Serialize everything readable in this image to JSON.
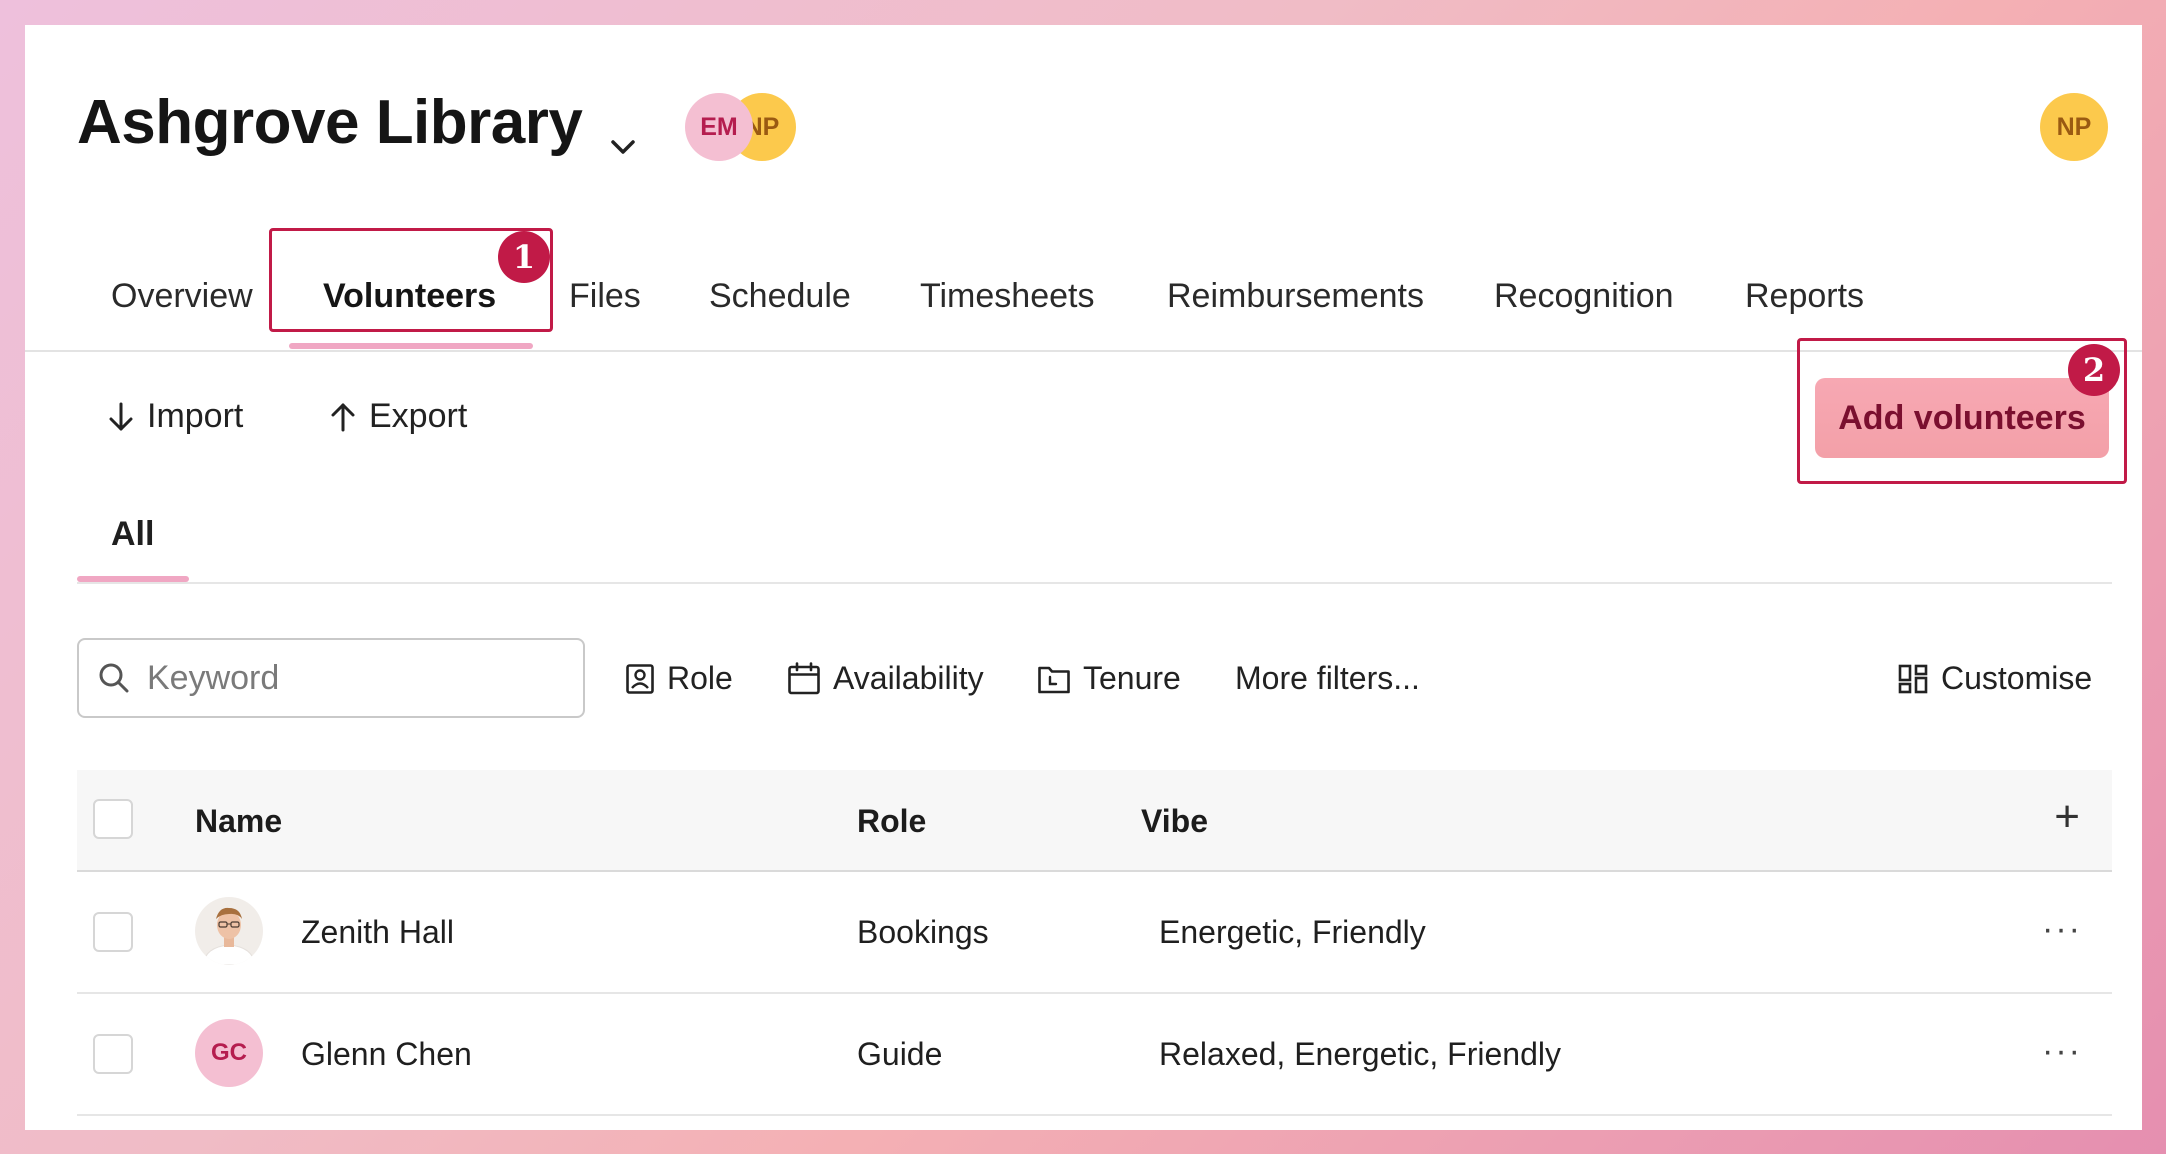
{
  "header": {
    "title": "Ashgrove Library",
    "member_avatars": [
      {
        "initials": "EM",
        "color": "#f4bfd2"
      },
      {
        "initials": "NP",
        "color": "#fcc94c"
      }
    ],
    "user_avatar": {
      "initials": "NP",
      "color": "#fcc94c"
    }
  },
  "tabs": [
    {
      "label": "Overview",
      "active": false
    },
    {
      "label": "Volunteers",
      "active": true
    },
    {
      "label": "Files",
      "active": false
    },
    {
      "label": "Schedule",
      "active": false
    },
    {
      "label": "Timesheets",
      "active": false
    },
    {
      "label": "Reimbursements",
      "active": false
    },
    {
      "label": "Recognition",
      "active": false
    },
    {
      "label": "Reports",
      "active": false
    }
  ],
  "annotations": {
    "badge_1": "1",
    "badge_2": "2"
  },
  "toolbar": {
    "import_label": "Import",
    "export_label": "Export",
    "add_label": "Add volunteers"
  },
  "subtabs": {
    "all_label": "All"
  },
  "filters": {
    "search_placeholder": "Keyword",
    "role_label": "Role",
    "availability_label": "Availability",
    "tenure_label": "Tenure",
    "more_label": "More filters...",
    "customise_label": "Customise"
  },
  "table": {
    "columns": {
      "name": "Name",
      "role": "Role",
      "vibe": "Vibe"
    },
    "rows": [
      {
        "name": "Zenith Hall",
        "role": "Bookings",
        "vibe": "Energetic, Friendly",
        "avatar": "photo"
      },
      {
        "name": "Glenn Chen",
        "role": "Guide",
        "vibe": "Relaxed, Energetic, Friendly",
        "avatar_initials": "GC"
      }
    ]
  },
  "colors": {
    "accent": "#c11a47",
    "tab_underline": "#f0a7c3",
    "button_bg": "#f7a8b3"
  }
}
